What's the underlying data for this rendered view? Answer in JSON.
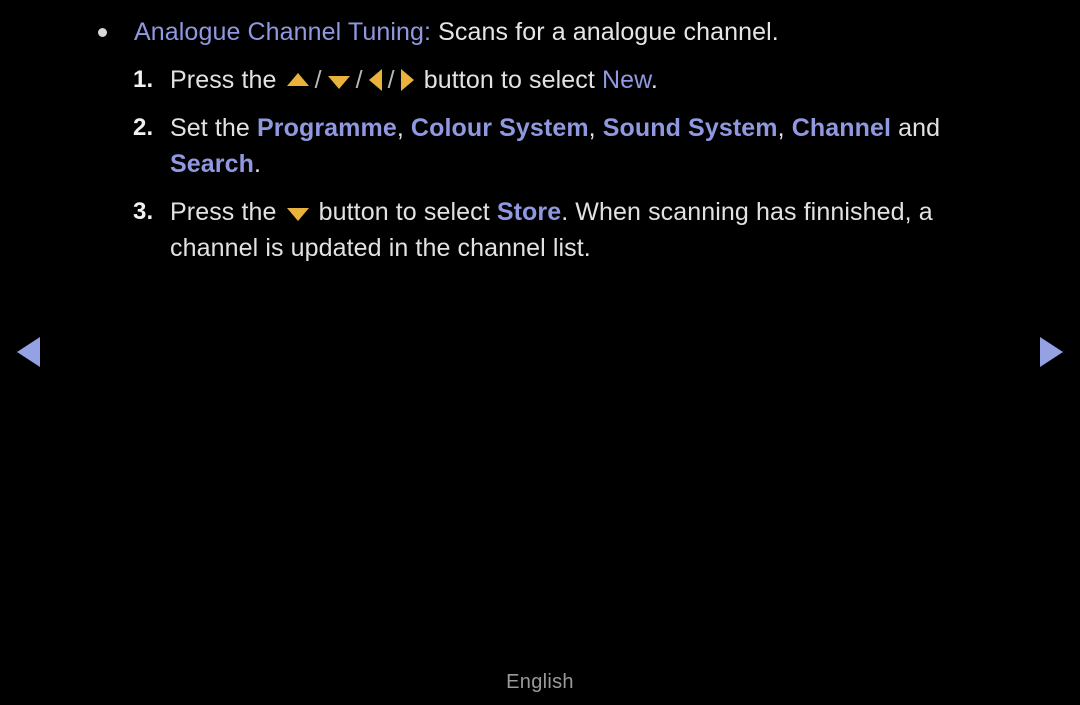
{
  "screen": {
    "background_color": "#000000",
    "body_text_color": "#e2e2e2",
    "accent_color": "#9098e0",
    "arrow_glyph_color": "#e8b23c",
    "nav_arrow_color": "#94a2e4"
  },
  "bullet": {
    "marker": "bullet-dot",
    "term": "Analogue Channel Tuning",
    "colon": ":",
    "description": " Scans for a analogue channel."
  },
  "steps": [
    {
      "number": "1.",
      "parts": {
        "lead": "Press the ",
        "arrow_up": "up-arrow",
        "sep1": "/",
        "arrow_down": "down-arrow",
        "sep2": "/",
        "arrow_left": "left-arrow",
        "sep3": "/",
        "arrow_right": "right-arrow",
        "mid": " button to select ",
        "keyword": "New",
        "tail": "."
      }
    },
    {
      "number": "2.",
      "parts": {
        "lead": "Set the ",
        "kw1": "Programme",
        "c1": ", ",
        "kw2": "Colour System",
        "c2": ", ",
        "kw3": "Sound System",
        "c3": ", ",
        "kw4": "Channel",
        "mid": " and ",
        "kw5": "Search",
        "tail": "."
      }
    },
    {
      "number": "3.",
      "parts": {
        "lead": "Press the ",
        "arrow_down": "down-arrow",
        "mid": " button to select ",
        "keyword": "Store",
        "tail": ". When scanning has finnished, a channel is updated in the channel list."
      }
    }
  ],
  "navigation": {
    "prev_label": "previous-page-arrow",
    "next_label": "next-page-arrow"
  },
  "footer": {
    "language": "English"
  }
}
